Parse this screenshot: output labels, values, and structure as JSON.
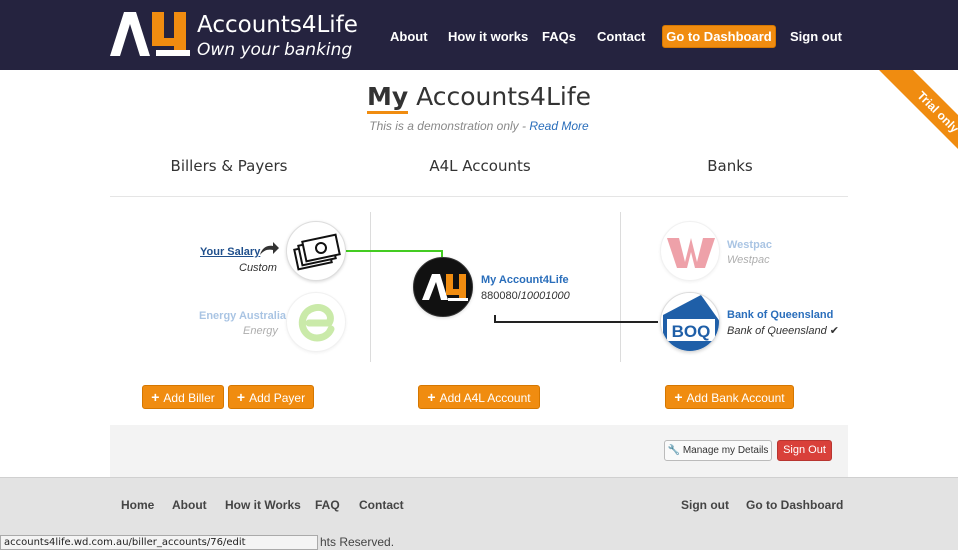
{
  "header": {
    "brand_name": "Accounts4Life",
    "brand_tagline": "Own your banking",
    "nav": [
      "About",
      "How it works",
      "FAQs",
      "Contact"
    ],
    "dashboard_button": "Go to Dashboard",
    "signout": "Sign out"
  },
  "ribbon": "Trial only",
  "page": {
    "title_my": "My",
    "title_rest": "Accounts4Life",
    "demo_text": "This is a demonstration only - ",
    "read_more": "Read More"
  },
  "columns": {
    "billers": "Billers & Payers",
    "a4l": "A4L Accounts",
    "banks": "Banks"
  },
  "billers": [
    {
      "name": "Your Salary",
      "type": "Custom"
    },
    {
      "name": "Energy Australia",
      "type": "Energy"
    }
  ],
  "a4l_account": {
    "name": "My Account4Life",
    "bsb": "880080/",
    "number": "10001000"
  },
  "banks": [
    {
      "name": "Westpac",
      "sub": "Westpac"
    },
    {
      "name": "Bank of Queensland",
      "sub": "Bank of Queensland",
      "check": "✔"
    }
  ],
  "buttons": {
    "add_biller": "Add Biller",
    "add_payer": "Add Payer",
    "add_a4l": "Add A4L Account",
    "add_bank": "Add Bank Account",
    "manage": "Manage my Details",
    "signout": "Sign Out",
    "plus": "+"
  },
  "footer": {
    "nav_left": [
      "Home",
      "About",
      "How it Works",
      "FAQ",
      "Contact"
    ],
    "nav_right": [
      "Sign out",
      "Go to Dashboard"
    ],
    "rights": "hts Reserved."
  },
  "statusbar": "accounts4life.wd.com.au/biller_accounts/76/edit",
  "colors": {
    "accent": "#f08c10",
    "header_bg": "#25233f",
    "link": "#2a6ebb",
    "danger": "#d9403a"
  }
}
